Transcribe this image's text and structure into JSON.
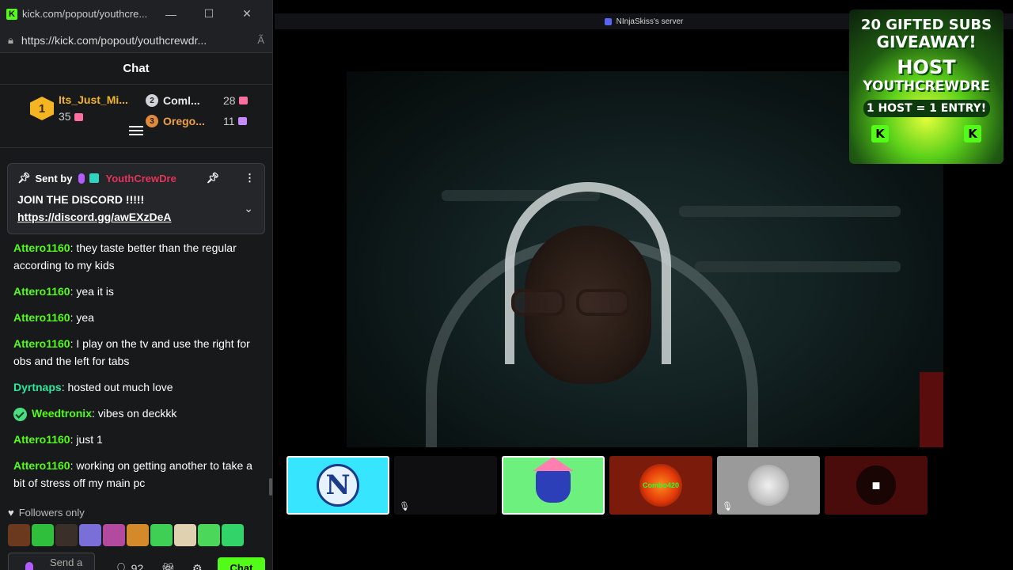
{
  "window": {
    "title": "kick.com/popout/youthcre...",
    "url": "https://kick.com/popout/youthcrewdr...",
    "controls": {
      "minimize": "—",
      "maximize": "☐",
      "close": "✕"
    }
  },
  "chat": {
    "header": "Chat",
    "leaderboard": {
      "first": {
        "rank": "1",
        "name": "Its_Just_Mi...",
        "count": "35"
      },
      "second": {
        "rank": "2",
        "name": "Coml...",
        "count": "28"
      },
      "third": {
        "rank": "3",
        "name": "Orego...",
        "count": "11"
      }
    },
    "pinned": {
      "sent_by_label": "Sent by",
      "username": "YouthCrewDre",
      "message": "JOIN THE DISCORD !!!!!",
      "link": "https://discord.gg/awEXzDeA"
    },
    "messages": [
      {
        "user": "Attero1160",
        "text": " they taste better than the regular according to my kids"
      },
      {
        "user": "Attero1160",
        "text": " yea it is"
      },
      {
        "user": "Attero1160",
        "text": " yea"
      },
      {
        "user": "Attero1160",
        "text": " I play on the tv and use the right for obs and the left for tabs"
      },
      {
        "user": "Dyrtnaps",
        "text": " hosted out much love"
      },
      {
        "user": "Weedtronix",
        "text": " vibes on deckkk"
      },
      {
        "user": "Attero1160",
        "text": " just 1"
      },
      {
        "user": "Attero1160",
        "text": " working on getting another to take a bit of stress off my main pc"
      }
    ],
    "followers_only": "Followers only",
    "input_placeholder": "Send a",
    "user_count": "92",
    "send_button": "Chat"
  },
  "stream": {
    "server_name": "NInjaSkiss's server",
    "promo": {
      "line1": "20 GIFTED SUBS",
      "line2": "GIVEAWAY!",
      "line3": "HOST",
      "line4": "YOUTHCREWDRE",
      "line5": "1 HOST = 1 ENTRY!",
      "k": "K"
    },
    "tiles": [
      {
        "name": "N"
      },
      {
        "name": ""
      },
      {
        "name": ""
      },
      {
        "name": "Combo420"
      },
      {
        "name": ""
      },
      {
        "name": ""
      }
    ]
  },
  "colors": {
    "kick_green": "#53fc18",
    "chat_bg": "#18191b",
    "pinned_user": "#e6335a",
    "gold": "#f5b422"
  },
  "icons": [
    "kick-logo-icon",
    "lock-icon",
    "read-mode-icon",
    "pin-icon",
    "mic-icon",
    "more-icon",
    "chevron-down-icon",
    "heart-icon",
    "user-icon",
    "settings-icon",
    "mute-icon",
    "camera-icon"
  ]
}
